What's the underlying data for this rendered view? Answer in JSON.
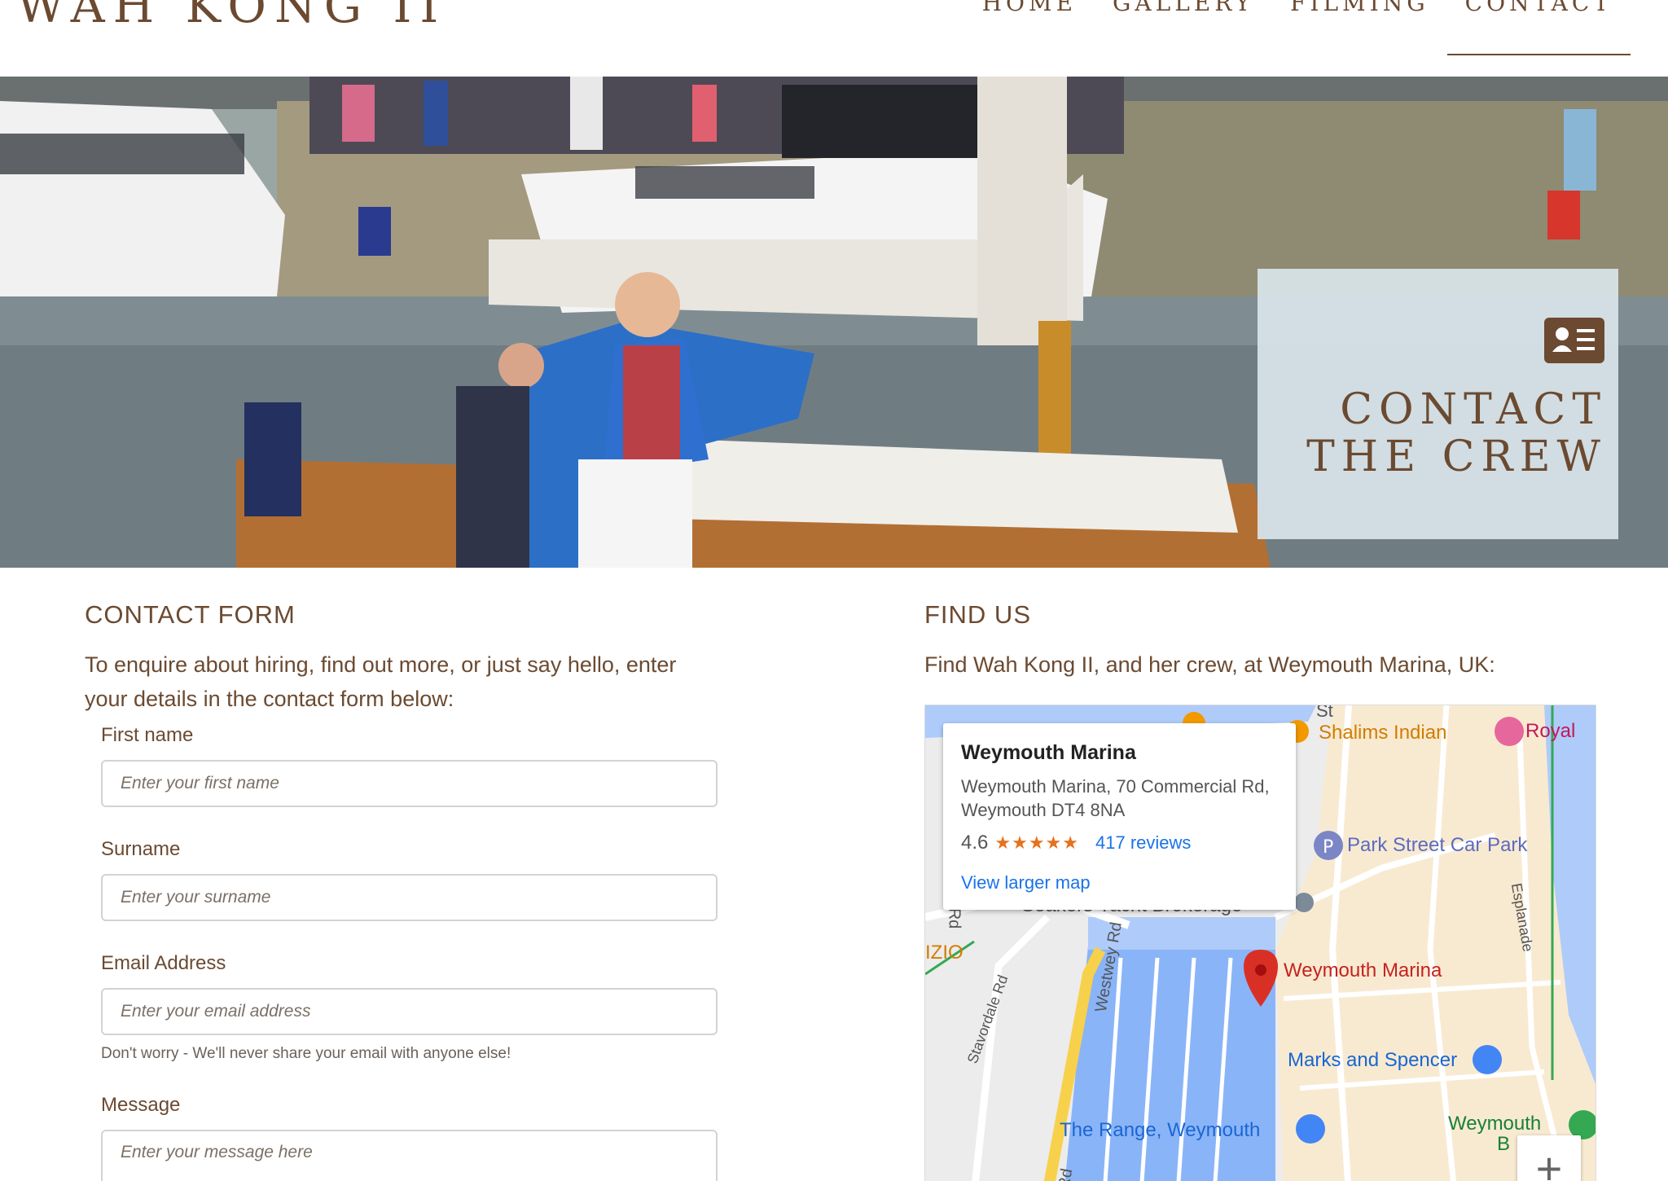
{
  "header": {
    "brand": "WAH KONG II",
    "nav": [
      {
        "label": "HOME"
      },
      {
        "label": "GALLERY"
      },
      {
        "label": "FILMING"
      },
      {
        "label": "CONTACT",
        "active": true
      }
    ]
  },
  "hero": {
    "icon": "contact-card-icon",
    "title_line1": "CONTACT",
    "title_line2": "THE CREW"
  },
  "contact": {
    "heading": "CONTACT FORM",
    "intro": "To enquire about hiring, find out more, or just say hello, enter your details in the contact form below:",
    "first_name": {
      "label": "First name",
      "placeholder": "Enter your first name"
    },
    "surname": {
      "label": "Surname",
      "placeholder": "Enter your surname"
    },
    "email": {
      "label": "Email Address",
      "placeholder": "Enter your email address",
      "help": "Don't worry - We'll never share your email with anyone else!"
    },
    "message": {
      "label": "Message",
      "placeholder": "Enter your message here"
    }
  },
  "find": {
    "heading": "FIND US",
    "intro": "Find Wah Kong II, and her crew, at Weymouth Marina, UK:",
    "popup": {
      "title": "Weymouth Marina",
      "address": "Weymouth Marina, 70 Commercial Rd, Weymouth DT4 8NA",
      "rating": "4.6",
      "stars": "★★★★★",
      "reviews": "417 reviews",
      "view_larger": "View larger map"
    },
    "map_labels": {
      "shalims": "Shalims Indian",
      "royal": "Royal",
      "park": "Park Street Car Park",
      "seakers": "Seakers Yacht Brokerage",
      "marina": "Weymouth Marina",
      "ms": "Marks and Spencer",
      "range": "The Range, Weymouth",
      "weymouth": "Weymouth",
      "b": "B",
      "westwey": "Westwey Rd",
      "stavordale": "Stavordale Rd",
      "esplanade": "Esplanade",
      "rd_left": "Rd",
      "rd_bottom": "Rd",
      "izio": "IZIO",
      "st": "St"
    },
    "zoom_in": "+"
  },
  "colors": {
    "brown": "#6b4a31",
    "card": "#d8e4ea",
    "link": "#1a73e8",
    "pin": "#d93025"
  }
}
